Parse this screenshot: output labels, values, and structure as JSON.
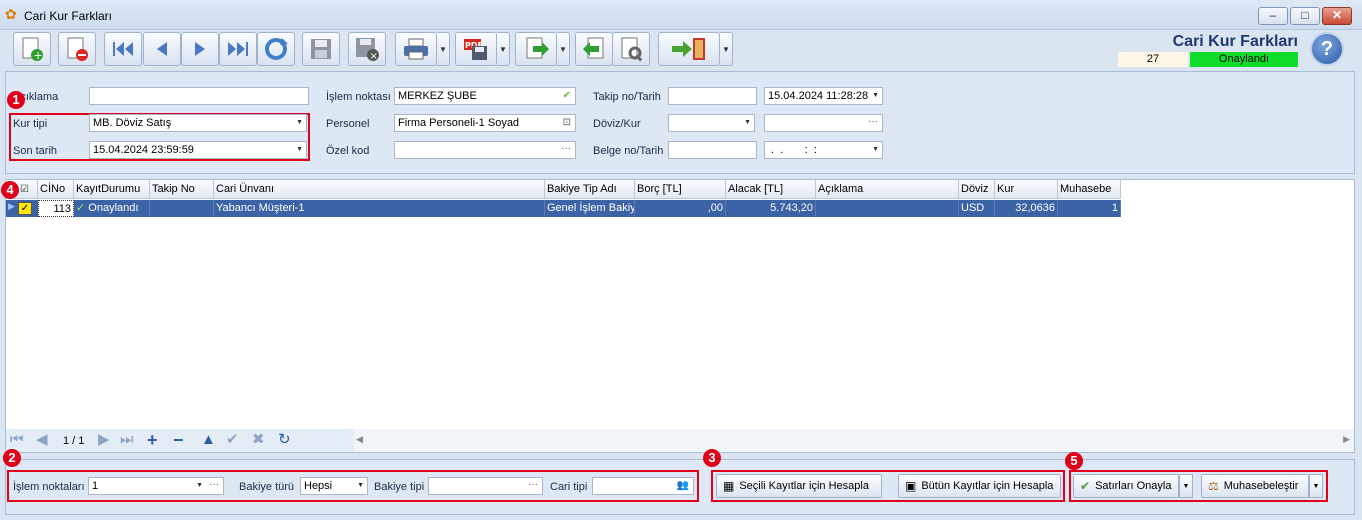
{
  "window": {
    "title": "Cari Kur Farkları",
    "app_icon": "butterfly-icon"
  },
  "toolbar": {
    "buttons": [
      "new-icon",
      "delete-icon",
      "first-icon",
      "previous-icon",
      "next-icon",
      "last-icon",
      "refresh-icon",
      "save-icon",
      "save-close-icon",
      "print-icon",
      "pdf-icon",
      "export-icon",
      "import-icon",
      "tools-icon",
      "exit-icon"
    ]
  },
  "header": {
    "title": "Cari Kur Farkları",
    "record_no": "27",
    "status": "Onaylandı",
    "status_color": "#10dd2a"
  },
  "form": {
    "aciklama_label": "Açıklama",
    "aciklama_value": "",
    "kur_tipi_label": "Kur tipi",
    "kur_tipi_value": "MB. Döviz Satış",
    "son_tarih_label": "Son tarih",
    "son_tarih_value": "15.04.2024 23:59:59",
    "islem_noktasi_label": "İşlem noktası",
    "islem_noktasi_value": "MERKEZ ŞUBE",
    "personel_label": "Personel",
    "personel_value": "Firma Personeli-1 Soyad",
    "ozel_kod_label": "Özel kod",
    "ozel_kod_value": "",
    "takip_label": "Takip no/Tarih",
    "takip_no_value": "",
    "takip_tarih_value": "15.04.2024 11:28:28",
    "doviz_kur_label": "Döviz/Kur",
    "doviz_value": "",
    "kur_value": "",
    "belge_label": "Belge no/Tarih",
    "belge_no_value": "",
    "belge_tarih_value": " .  .       :  :"
  },
  "grid": {
    "columns": [
      "CİNo",
      "KayıtDurumu",
      "Takip No",
      "Cari Ünvanı",
      "Bakiye Tip Adı",
      "Borç [TL]",
      "Alacak [TL]",
      "Açıklama",
      "Döviz",
      "Kur",
      "Muhasebe"
    ],
    "rows": [
      {
        "cino": "113",
        "kayit_durumu": "Onaylandı",
        "takip_no": "",
        "cari_unvani": "Yabancı Müşteri-1",
        "bakiye_tip_adi": "Genel İşlem Bakiye",
        "borc": ",00",
        "alacak": "5.743,20",
        "aciklama": "",
        "doviz": "USD",
        "kur": "32,0636",
        "muhasebe": "1"
      }
    ],
    "selected_row_color": "#3b63a5",
    "pager": "1 / 1"
  },
  "filters": {
    "islem_noktalari_label": "İşlem noktaları",
    "islem_noktalari_value": "1",
    "bakiye_turu_label": "Bakiye türü",
    "bakiye_turu_value": "Hepsi",
    "bakiye_tipi_label": "Bakiye tipi",
    "bakiye_tipi_value": "",
    "cari_tipi_label": "Cari tipi",
    "cari_tipi_value": ""
  },
  "actions": {
    "secili_label": "Seçili Kayıtlar için Hesapla",
    "butun_label": "Bütün Kayıtlar için Hesapla",
    "onayla_label": "Satırları Onayla",
    "muhasebe_label": "Muhasebeleştir"
  },
  "badges": [
    "1",
    "2",
    "3",
    "4",
    "5"
  ],
  "highlight_color": "#e0001a"
}
